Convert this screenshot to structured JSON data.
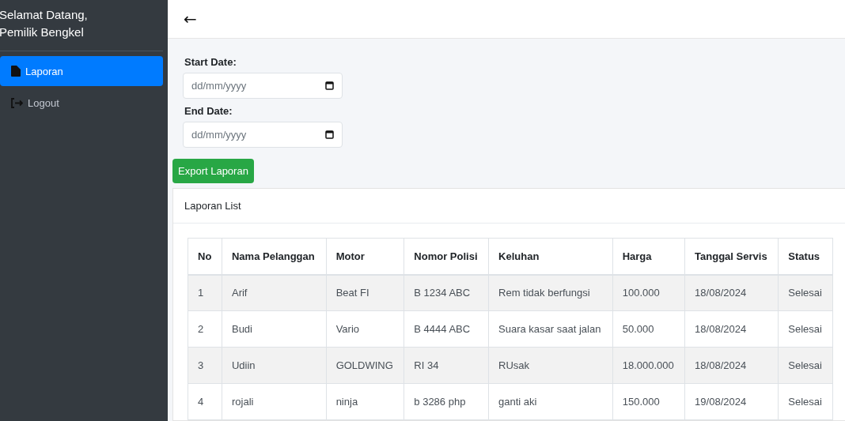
{
  "sidebar": {
    "greeting": "Selamat Datang,",
    "subtitle": "Pemilik Bengkel",
    "items": [
      {
        "label": "Laporan",
        "kind": "file",
        "selected": true
      },
      {
        "label": "Logout",
        "kind": "logout",
        "selected": false
      }
    ]
  },
  "topbar": {
    "back": "←"
  },
  "filters": [
    {
      "label": "Start Date:",
      "placeholder": "dd/mm/yyyy"
    },
    {
      "label": "End Date:",
      "placeholder": "dd/mm/yyyy"
    }
  ],
  "export_button": "Export Laporan",
  "card": {
    "title": "Laporan List",
    "table": {
      "columns": [
        "No",
        "Nama Pelanggan",
        "Motor",
        "Nomor Polisi",
        "Keluhan",
        "Harga",
        "Tanggal Servis",
        "Status"
      ],
      "rows": [
        [
          "1",
          "Arif",
          "Beat FI",
          "B 1234 ABC",
          "Rem tidak berfungsi",
          "100.000",
          "18/08/2024",
          "Selesai"
        ],
        [
          "2",
          "Budi",
          "Vario",
          "B 4444 ABC",
          "Suara kasar saat jalan",
          "50.000",
          "18/08/2024",
          "Selesai"
        ],
        [
          "3",
          "Udiin",
          "GOLDWING",
          "RI 34",
          "RUsak",
          "18.000.000",
          "18/08/2024",
          "Selesai"
        ],
        [
          "4",
          "rojali",
          "ninja",
          "b 3286 php",
          "ganti aki",
          "150.000",
          "19/08/2024",
          "Selesai"
        ]
      ]
    }
  }
}
